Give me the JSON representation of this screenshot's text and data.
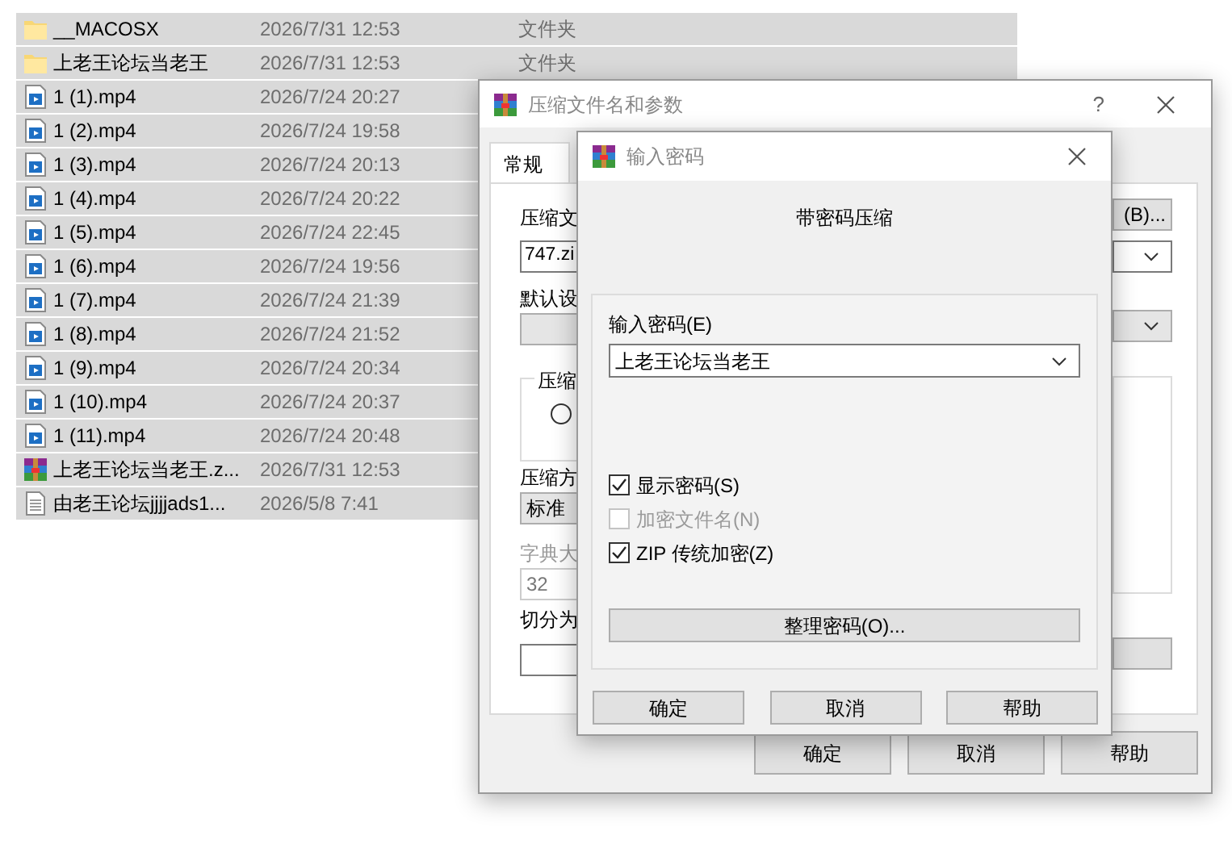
{
  "file_list": {
    "rows": [
      {
        "kind": "folder",
        "name": "__MACOSX",
        "modified": "2026/7/31 12:53",
        "type": "文件夹",
        "selected": true
      },
      {
        "kind": "folder",
        "name": "上老王论坛当老王",
        "modified": "2026/7/31 12:53",
        "type": "文件夹",
        "selected": true
      },
      {
        "kind": "video",
        "name": "1 (1).mp4",
        "modified": "2026/7/24 20:27",
        "selected": true
      },
      {
        "kind": "video",
        "name": "1 (2).mp4",
        "modified": "2026/7/24 19:58",
        "selected": true
      },
      {
        "kind": "video",
        "name": "1 (3).mp4",
        "modified": "2026/7/24 20:13",
        "selected": true
      },
      {
        "kind": "video",
        "name": "1 (4).mp4",
        "modified": "2026/7/24 20:22",
        "selected": true
      },
      {
        "kind": "video",
        "name": "1 (5).mp4",
        "modified": "2026/7/24 22:45",
        "selected": true
      },
      {
        "kind": "video",
        "name": "1 (6).mp4",
        "modified": "2026/7/24 19:56",
        "selected": true
      },
      {
        "kind": "video",
        "name": "1 (7).mp4",
        "modified": "2026/7/24 21:39",
        "selected": true
      },
      {
        "kind": "video",
        "name": "1 (8).mp4",
        "modified": "2026/7/24 21:52",
        "selected": true
      },
      {
        "kind": "video",
        "name": "1 (9).mp4",
        "modified": "2026/7/24 20:34",
        "selected": true
      },
      {
        "kind": "video",
        "name": "1 (10).mp4",
        "modified": "2026/7/24 20:37",
        "selected": true
      },
      {
        "kind": "video",
        "name": "1 (11).mp4",
        "modified": "2026/7/24 20:48",
        "selected": true
      },
      {
        "kind": "archive",
        "name": "上老王论坛当老王.z...",
        "modified": "2026/7/31 12:53",
        "selected": true
      },
      {
        "kind": "text",
        "name": "由老王论坛jjjjads1...",
        "modified": "2026/5/8 7:41",
        "selected": true
      }
    ]
  },
  "archive_dialog": {
    "title": "压缩文件名和参数",
    "help": "?",
    "tabs": [
      {
        "label": "常规",
        "selected": true
      }
    ],
    "archive_name_label": "压缩文",
    "browse_button": "(B)...",
    "archive_name_value": "747.zi",
    "profile_label": "默认设",
    "update_group_label": "压缩",
    "update_radio_selected": false,
    "method_label": "压缩方",
    "method_value": "标准",
    "dictionary_label": "字典大",
    "dictionary_value": "32",
    "split_label": "切分为",
    "buttons": [
      "确定",
      "取消",
      "帮助"
    ]
  },
  "password_dialog": {
    "title": "输入密码",
    "heading": "带密码压缩",
    "password_label": "输入密码(E)",
    "password_value": "上老王论坛当老王",
    "options": [
      {
        "label": "显示密码(S)",
        "checked": true,
        "disabled": false
      },
      {
        "label": "加密文件名(N)",
        "checked": false,
        "disabled": true
      },
      {
        "label": "ZIP 传统加密(Z)",
        "checked": true,
        "disabled": false
      }
    ],
    "organize_button": "整理密码(O)...",
    "buttons": [
      "确定",
      "取消",
      "帮助"
    ]
  }
}
